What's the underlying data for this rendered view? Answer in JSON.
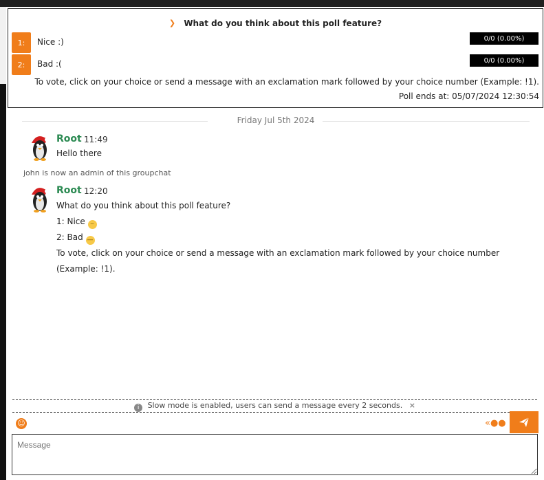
{
  "poll": {
    "question": "What do you think about this poll feature?",
    "choices": [
      {
        "number": "1:",
        "label": "Nice :)",
        "result": "0/0 (0.00%)"
      },
      {
        "number": "2:",
        "label": "Bad :(",
        "result": "0/0 (0.00%)"
      }
    ],
    "instructions": "To vote, click on your choice or send a message with an exclamation mark followed by your choice number (Example: !1).",
    "ends": "Poll ends at: 05/07/2024 12:30:54"
  },
  "date_separator": "Friday Jul 5th 2024",
  "messages": [
    {
      "author": "Root",
      "time": "11:49",
      "lines": [
        "Hello there"
      ]
    },
    {
      "author": "Root",
      "time": "12:20",
      "lines": [
        "What do you think about this poll feature?",
        "1: Nice",
        "2: Bad",
        "To vote, click on your choice or send a message with an exclamation mark followed by your choice number",
        "(Example: !1)."
      ]
    }
  ],
  "system_message": "john is now an admin of this groupchat",
  "slow_mode": "Slow mode is enabled, users can send a message every 2 seconds.",
  "input": {
    "placeholder": "Message"
  },
  "colors": {
    "accent": "#f07d1a",
    "author": "#2b8a52"
  }
}
